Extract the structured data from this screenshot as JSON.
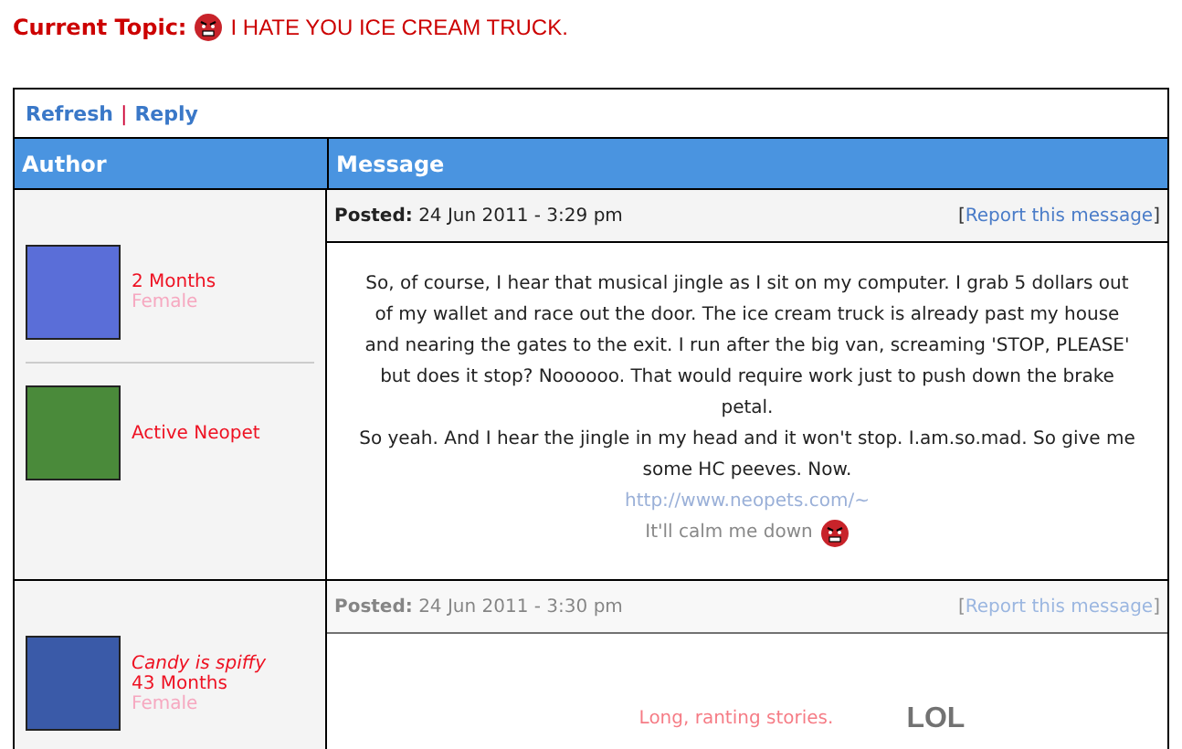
{
  "topic": {
    "label": "Current Topic:",
    "title": "I HATE YOU ICE CREAM TRUCK."
  },
  "toolbar": {
    "links": [
      "Refresh",
      "Reply"
    ],
    "separator": "|"
  },
  "table": {
    "columns": [
      "Author",
      "Message"
    ]
  },
  "posts": [
    {
      "dimmed": false,
      "author": {
        "lines": [
          {
            "kind": "age",
            "text": "2 Months"
          },
          {
            "kind": "gender",
            "text": "Female"
          }
        ],
        "pet": "Active Neopet"
      },
      "posted_label": "Posted:",
      "date": "24 Jun 2011 - 3:29 pm",
      "report": "Report this message",
      "report_brackets": [
        "[",
        "]"
      ],
      "body": [
        {
          "kind": "text",
          "text": "So, of course, I hear that musical jingle as I sit on my computer. I grab 5 dollars out of my wallet and race out the door. The ice cream truck is already past my house and nearing the gates to the exit. I run after the big van, screaming 'STOP, PLEASE' but does it stop? Noooooo. That would require work just to push down the brake petal."
        },
        {
          "kind": "text",
          "text": "So yeah. And I hear the jingle in my head and it won't stop. I.am.so.mad. So give me some HC peeves. Now."
        },
        {
          "kind": "link",
          "text": "http://www.neopets.com/~"
        },
        {
          "kind": "signature",
          "text": "It'll calm me down"
        }
      ]
    },
    {
      "dimmed": true,
      "author": {
        "lines": [
          {
            "kind": "title",
            "text": "Candy is spiffy"
          },
          {
            "kind": "age",
            "text": "43 Months"
          },
          {
            "kind": "gender",
            "text": "Female"
          }
        ]
      },
      "posted_label": "Posted:",
      "date": "24 Jun 2011 - 3:30 pm",
      "report": "Report this message",
      "report_brackets": [
        "[",
        "]"
      ],
      "body": [
        {
          "kind": "quote",
          "text": "Long, ranting stories."
        },
        {
          "kind": "shout",
          "text": "LOL"
        }
      ]
    }
  ]
}
